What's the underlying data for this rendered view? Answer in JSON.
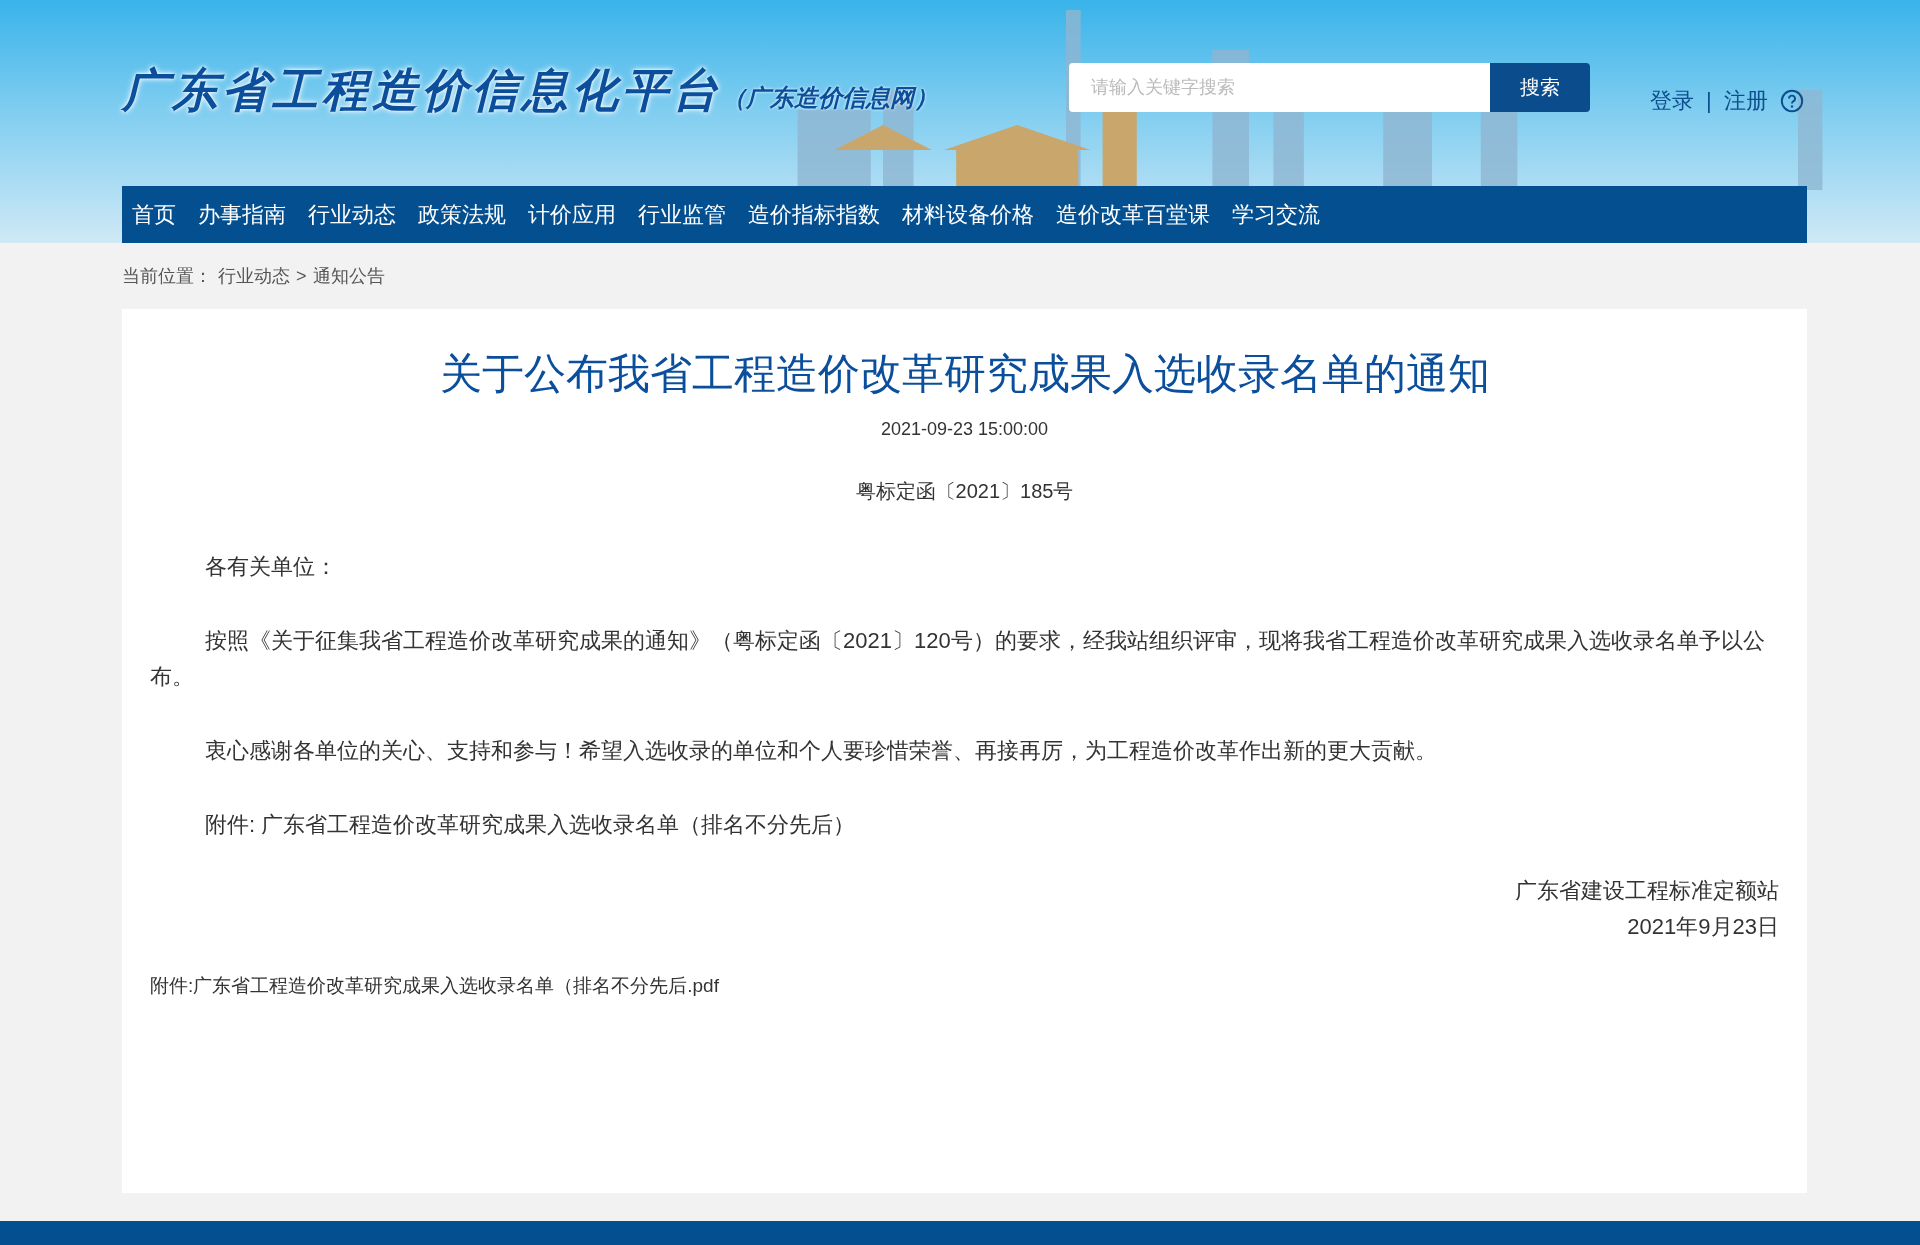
{
  "header": {
    "logo_title": "广东省工程造价信息化平台",
    "logo_subtitle": "（广东造价信息网）",
    "search": {
      "placeholder": "请输入关键字搜索",
      "button": "搜索"
    },
    "login": "登录",
    "separator": "|",
    "register": "注册"
  },
  "nav": {
    "items": [
      {
        "label": "首页"
      },
      {
        "label": "办事指南"
      },
      {
        "label": "行业动态"
      },
      {
        "label": "政策法规"
      },
      {
        "label": "计价应用"
      },
      {
        "label": "行业监管"
      },
      {
        "label": "造价指标指数"
      },
      {
        "label": "材料设备价格"
      },
      {
        "label": "造价改革百堂课"
      },
      {
        "label": "学习交流"
      }
    ]
  },
  "breadcrumb": {
    "prefix": "当前位置：",
    "items": [
      "行业动态",
      "通知公告"
    ],
    "separator": ">"
  },
  "article": {
    "title": "关于公布我省工程造价改革研究成果入选收录名单的通知",
    "datetime": "2021-09-23 15:00:00",
    "doc_number": "粤标定函〔2021〕185号",
    "paragraphs": [
      "各有关单位：",
      "按照《关于征集我省工程造价改革研究成果的通知》（粤标定函〔2021〕120号）的要求，经我站组织评审，现将我省工程造价改革研究成果入选收录名单予以公布。",
      "衷心感谢各单位的关心、支持和参与！希望入选收录的单位和个人要珍惜荣誉、再接再厉，为工程造价改革作出新的更大贡献。",
      "附件: 广东省工程造价改革研究成果入选收录名单（排名不分先后）"
    ],
    "signature": [
      "广东省建设工程标准定额站",
      "2021年9月23日"
    ],
    "attachment_link": "附件:广东省工程造价改革研究成果入选收录名单（排名不分先后.pdf"
  }
}
